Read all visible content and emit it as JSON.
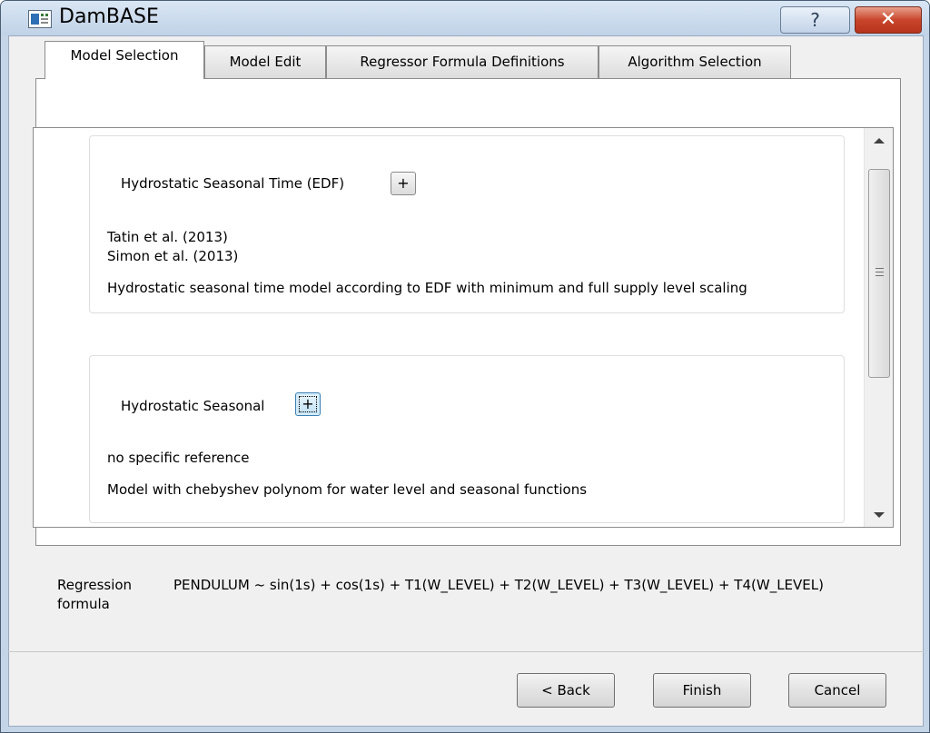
{
  "window": {
    "title": "DamBASE",
    "help_label": "?",
    "close_label": "✕"
  },
  "tabs": [
    {
      "label": "Model Selection",
      "active": true
    },
    {
      "label": "Model Edit",
      "active": false
    },
    {
      "label": "Regressor Formula Definitions",
      "active": false
    },
    {
      "label": "Algorithm Selection",
      "active": false
    }
  ],
  "models": [
    {
      "name": "Hydrostatic Seasonal Time (EDF)",
      "add_label": "+",
      "references": [
        "Tatin et al. (2013)",
        "Simon et al. (2013)"
      ],
      "description": "Hydrostatic seasonal time model according to EDF with minimum and full supply level scaling"
    },
    {
      "name": "Hydrostatic Seasonal",
      "add_label": "+",
      "references": [
        "no specific reference"
      ],
      "description": "Model with chebyshev polynom for water level and seasonal functions"
    }
  ],
  "regression": {
    "label": "Regression formula",
    "formula": "PENDULUM ~ sin(1s) + cos(1s) + T1(W_LEVEL) + T2(W_LEVEL) + T3(W_LEVEL) + T4(W_LEVEL)"
  },
  "buttons": {
    "back": "< Back",
    "finish": "Finish",
    "cancel": "Cancel"
  }
}
